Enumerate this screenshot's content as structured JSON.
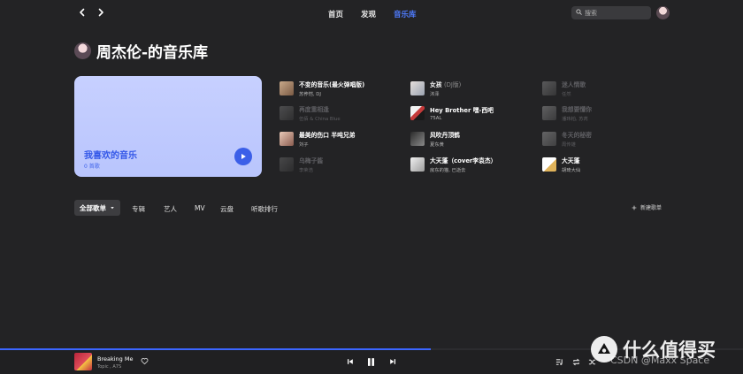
{
  "topbar": {
    "nav": [
      {
        "label": "首页",
        "active": false
      },
      {
        "label": "发现",
        "active": false
      },
      {
        "label": "音乐库",
        "active": true
      }
    ],
    "search_placeholder": "搜索"
  },
  "page_title": "周杰伦-的音乐库",
  "favorite": {
    "title": "我喜欢的音乐",
    "count": "0 首歌"
  },
  "songs": [
    {
      "name": "不变的音乐(最火弹唱版)",
      "tag": "",
      "artist": "苏荞恺, DJ",
      "dim": false
    },
    {
      "name": "女孩",
      "tag": "(DJ版)",
      "artist": "沐泽",
      "dim": false
    },
    {
      "name": "迷人情歌",
      "tag": "",
      "artist": "任然",
      "dim": true
    },
    {
      "name": "再度重相逢",
      "tag": "",
      "artist": "伍佰 & China Blue",
      "dim": true
    },
    {
      "name": "Hey Brother 嘿-西吧",
      "tag": "",
      "artist": "75AL",
      "dim": false
    },
    {
      "name": "我想要懂你",
      "tag": "",
      "artist": "潘玮柏, 苏芮",
      "dim": true
    },
    {
      "name": "最美的伤口 半吨兄弟",
      "tag": "",
      "artist": "刘子",
      "dim": false
    },
    {
      "name": "风吹丹顶鹤",
      "tag": "",
      "artist": "夏东黄",
      "dim": false
    },
    {
      "name": "冬天的秘密",
      "tag": "",
      "artist": "周传雄",
      "dim": true
    },
    {
      "name": "乌梅子酱",
      "tag": "",
      "artist": "李荣浩",
      "dim": true
    },
    {
      "name": "大天蓬（cover李袁杰）",
      "tag": "",
      "artist": "房东的猫, 已逝去",
      "dim": false
    },
    {
      "name": "大天蓬",
      "tag": "",
      "artist": "胡琦大仙",
      "dim": false
    }
  ],
  "tabs": [
    {
      "label": "全部歌单",
      "active": true
    },
    {
      "label": "专辑",
      "active": false
    },
    {
      "label": "艺人",
      "active": false
    },
    {
      "label": "MV",
      "active": false
    },
    {
      "label": "云盘",
      "active": false
    },
    {
      "label": "听歌排行",
      "active": false
    }
  ],
  "new_playlist_label": "新建歌单",
  "player": {
    "title": "Breaking Me",
    "artist": "Topic , A7S",
    "progress": 0.58
  },
  "watermark": {
    "text": "什么值得买",
    "sub": "CSDN @Maxx Space"
  },
  "colors": {
    "background": "#232325",
    "accent": "#4f7cff",
    "favorite_card": "#c2ccff",
    "play_button": "#3b5fe8"
  }
}
